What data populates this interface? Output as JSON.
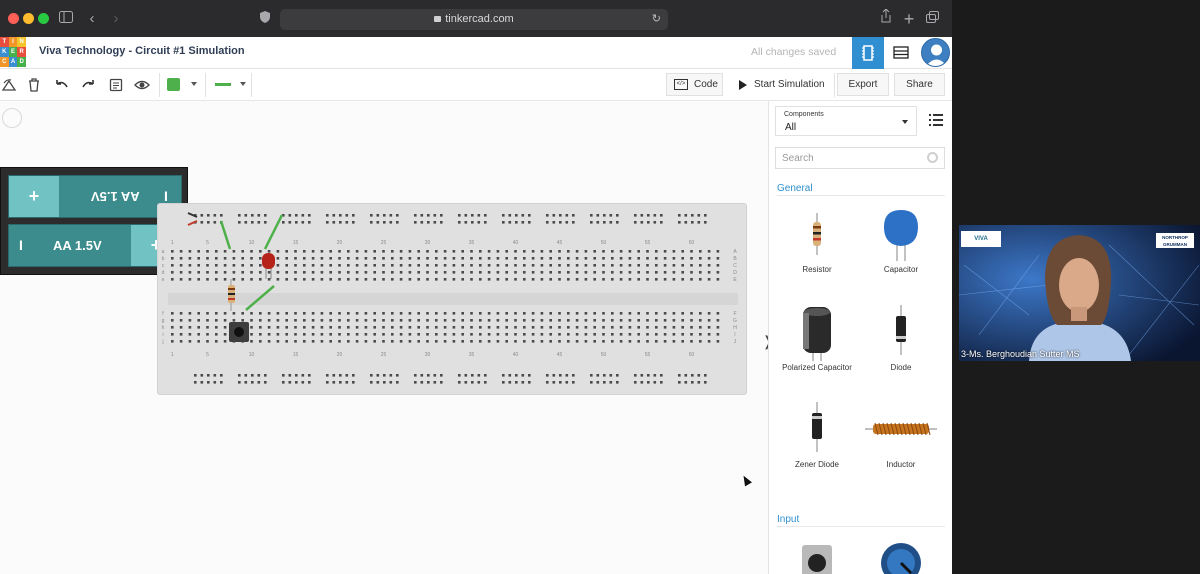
{
  "browser": {
    "url": "tinkercad.com",
    "traffic_colors": [
      "#fe5f57",
      "#febc2e",
      "#28c840"
    ]
  },
  "app": {
    "logo_letters": [
      "T",
      "I",
      "N",
      "K",
      "E",
      "R",
      "C",
      "A",
      "D"
    ],
    "logo_colors": [
      "#e94e3c",
      "#f29727",
      "#f7c52b",
      "#3b8fd1",
      "#46b04a",
      "#e94e3c",
      "#f29727",
      "#3b8fd1",
      "#46b04a"
    ],
    "title": "Viva Technology - Circuit #1 Simulation",
    "save_status": "All changes saved"
  },
  "toolbar": {
    "code_label": "Code",
    "start_label": "Start Simulation",
    "export_label": "Export",
    "share_label": "Share",
    "wire_color": "#4db04a"
  },
  "battery": {
    "top_label": "AA 1.5V",
    "bottom_label": "AA 1.5V",
    "plus": "+",
    "minus": "I"
  },
  "breadboard": {
    "column_numbers": [
      "1",
      "5",
      "10",
      "15",
      "20",
      "25",
      "30",
      "35",
      "40",
      "45",
      "50",
      "55",
      "60"
    ],
    "row_letters_top": [
      "A",
      "B",
      "C",
      "D",
      "E"
    ],
    "row_letters_bottom": [
      "F",
      "G",
      "H",
      "I",
      "J"
    ]
  },
  "panel": {
    "components_caption": "Components",
    "components_value": "All",
    "search_placeholder": "Search",
    "general_label": "General",
    "input_label": "Input",
    "items": [
      {
        "name": "Resistor",
        "icon": "resistor-icon"
      },
      {
        "name": "Capacitor",
        "icon": "capacitor-icon"
      },
      {
        "name": "Polarized Capacitor",
        "icon": "polarized-capacitor-icon"
      },
      {
        "name": "Diode",
        "icon": "diode-icon"
      },
      {
        "name": "Zener Diode",
        "icon": "zener-diode-icon"
      },
      {
        "name": "Inductor",
        "icon": "inductor-icon"
      }
    ]
  },
  "video": {
    "participant": "3-Ms. Berghoudian Sutter MS",
    "logo_left": "VIVA",
    "logo_right": "NORTHROP GRUMMAN"
  }
}
